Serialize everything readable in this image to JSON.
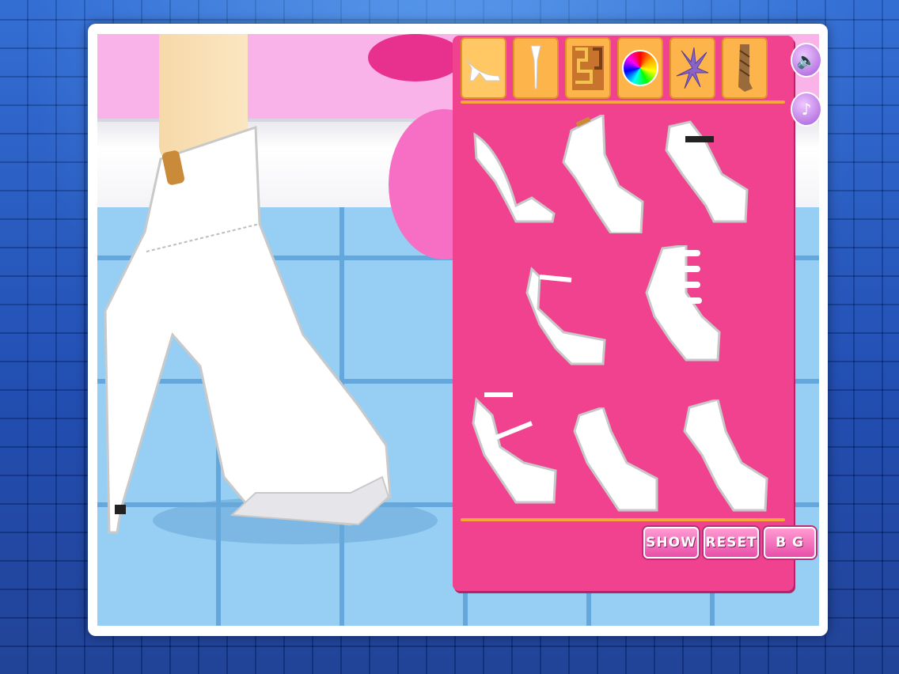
{
  "game": {
    "theme_colors": {
      "panel": "#f0428f",
      "tool_tab": "#fdb54b",
      "button": "#e84fa8"
    }
  },
  "toolbar": {
    "tabs": [
      {
        "icon": "high-heel-shoe-icon",
        "selected": true
      },
      {
        "icon": "stiletto-heel-icon",
        "selected": false
      },
      {
        "icon": "pattern-icon",
        "selected": false
      },
      {
        "icon": "color-wheel-icon",
        "selected": false
      },
      {
        "icon": "flower-accessory-icon",
        "selected": false
      },
      {
        "icon": "stocking-icon",
        "selected": false
      }
    ]
  },
  "side_controls": {
    "sound_icon": "speaker-icon",
    "music_icon": "music-note-icon"
  },
  "shoe_options": [
    {
      "style": "pump"
    },
    {
      "style": "ankle-boot-buckle"
    },
    {
      "style": "strap-bootie"
    },
    {
      "style": "ankle-strap-sandal"
    },
    {
      "style": "buckle-boot"
    },
    {
      "style": "cross-strap-platform"
    },
    {
      "style": "platform-bootie"
    },
    {
      "style": "peep-platform"
    }
  ],
  "buttons": {
    "show": "SHOW",
    "reset": "RESET",
    "bg": "B G"
  }
}
